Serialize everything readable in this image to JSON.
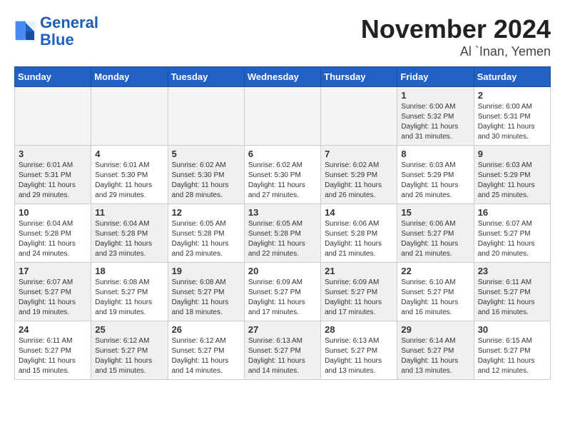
{
  "logo": {
    "line1": "General",
    "line2": "Blue"
  },
  "title": "November 2024",
  "location": "Al `Inan, Yemen",
  "days_of_week": [
    "Sunday",
    "Monday",
    "Tuesday",
    "Wednesday",
    "Thursday",
    "Friday",
    "Saturday"
  ],
  "weeks": [
    [
      {
        "num": "",
        "info": "",
        "empty": true
      },
      {
        "num": "",
        "info": "",
        "empty": true
      },
      {
        "num": "",
        "info": "",
        "empty": true
      },
      {
        "num": "",
        "info": "",
        "empty": true
      },
      {
        "num": "",
        "info": "",
        "empty": true
      },
      {
        "num": "1",
        "info": "Sunrise: 6:00 AM\nSunset: 5:32 PM\nDaylight: 11 hours\nand 31 minutes.",
        "shaded": true
      },
      {
        "num": "2",
        "info": "Sunrise: 6:00 AM\nSunset: 5:31 PM\nDaylight: 11 hours\nand 30 minutes.",
        "shaded": false
      }
    ],
    [
      {
        "num": "3",
        "info": "Sunrise: 6:01 AM\nSunset: 5:31 PM\nDaylight: 11 hours\nand 29 minutes.",
        "shaded": true
      },
      {
        "num": "4",
        "info": "Sunrise: 6:01 AM\nSunset: 5:30 PM\nDaylight: 11 hours\nand 29 minutes.",
        "shaded": false
      },
      {
        "num": "5",
        "info": "Sunrise: 6:02 AM\nSunset: 5:30 PM\nDaylight: 11 hours\nand 28 minutes.",
        "shaded": true
      },
      {
        "num": "6",
        "info": "Sunrise: 6:02 AM\nSunset: 5:30 PM\nDaylight: 11 hours\nand 27 minutes.",
        "shaded": false
      },
      {
        "num": "7",
        "info": "Sunrise: 6:02 AM\nSunset: 5:29 PM\nDaylight: 11 hours\nand 26 minutes.",
        "shaded": true
      },
      {
        "num": "8",
        "info": "Sunrise: 6:03 AM\nSunset: 5:29 PM\nDaylight: 11 hours\nand 26 minutes.",
        "shaded": false
      },
      {
        "num": "9",
        "info": "Sunrise: 6:03 AM\nSunset: 5:29 PM\nDaylight: 11 hours\nand 25 minutes.",
        "shaded": true
      }
    ],
    [
      {
        "num": "10",
        "info": "Sunrise: 6:04 AM\nSunset: 5:28 PM\nDaylight: 11 hours\nand 24 minutes.",
        "shaded": false
      },
      {
        "num": "11",
        "info": "Sunrise: 6:04 AM\nSunset: 5:28 PM\nDaylight: 11 hours\nand 23 minutes.",
        "shaded": true
      },
      {
        "num": "12",
        "info": "Sunrise: 6:05 AM\nSunset: 5:28 PM\nDaylight: 11 hours\nand 23 minutes.",
        "shaded": false
      },
      {
        "num": "13",
        "info": "Sunrise: 6:05 AM\nSunset: 5:28 PM\nDaylight: 11 hours\nand 22 minutes.",
        "shaded": true
      },
      {
        "num": "14",
        "info": "Sunrise: 6:06 AM\nSunset: 5:28 PM\nDaylight: 11 hours\nand 21 minutes.",
        "shaded": false
      },
      {
        "num": "15",
        "info": "Sunrise: 6:06 AM\nSunset: 5:27 PM\nDaylight: 11 hours\nand 21 minutes.",
        "shaded": true
      },
      {
        "num": "16",
        "info": "Sunrise: 6:07 AM\nSunset: 5:27 PM\nDaylight: 11 hours\nand 20 minutes.",
        "shaded": false
      }
    ],
    [
      {
        "num": "17",
        "info": "Sunrise: 6:07 AM\nSunset: 5:27 PM\nDaylight: 11 hours\nand 19 minutes.",
        "shaded": true
      },
      {
        "num": "18",
        "info": "Sunrise: 6:08 AM\nSunset: 5:27 PM\nDaylight: 11 hours\nand 19 minutes.",
        "shaded": false
      },
      {
        "num": "19",
        "info": "Sunrise: 6:08 AM\nSunset: 5:27 PM\nDaylight: 11 hours\nand 18 minutes.",
        "shaded": true
      },
      {
        "num": "20",
        "info": "Sunrise: 6:09 AM\nSunset: 5:27 PM\nDaylight: 11 hours\nand 17 minutes.",
        "shaded": false
      },
      {
        "num": "21",
        "info": "Sunrise: 6:09 AM\nSunset: 5:27 PM\nDaylight: 11 hours\nand 17 minutes.",
        "shaded": true
      },
      {
        "num": "22",
        "info": "Sunrise: 6:10 AM\nSunset: 5:27 PM\nDaylight: 11 hours\nand 16 minutes.",
        "shaded": false
      },
      {
        "num": "23",
        "info": "Sunrise: 6:11 AM\nSunset: 5:27 PM\nDaylight: 11 hours\nand 16 minutes.",
        "shaded": true
      }
    ],
    [
      {
        "num": "24",
        "info": "Sunrise: 6:11 AM\nSunset: 5:27 PM\nDaylight: 11 hours\nand 15 minutes.",
        "shaded": false
      },
      {
        "num": "25",
        "info": "Sunrise: 6:12 AM\nSunset: 5:27 PM\nDaylight: 11 hours\nand 15 minutes.",
        "shaded": true
      },
      {
        "num": "26",
        "info": "Sunrise: 6:12 AM\nSunset: 5:27 PM\nDaylight: 11 hours\nand 14 minutes.",
        "shaded": false
      },
      {
        "num": "27",
        "info": "Sunrise: 6:13 AM\nSunset: 5:27 PM\nDaylight: 11 hours\nand 14 minutes.",
        "shaded": true
      },
      {
        "num": "28",
        "info": "Sunrise: 6:13 AM\nSunset: 5:27 PM\nDaylight: 11 hours\nand 13 minutes.",
        "shaded": false
      },
      {
        "num": "29",
        "info": "Sunrise: 6:14 AM\nSunset: 5:27 PM\nDaylight: 11 hours\nand 13 minutes.",
        "shaded": true
      },
      {
        "num": "30",
        "info": "Sunrise: 6:15 AM\nSunset: 5:27 PM\nDaylight: 11 hours\nand 12 minutes.",
        "shaded": false
      }
    ]
  ]
}
